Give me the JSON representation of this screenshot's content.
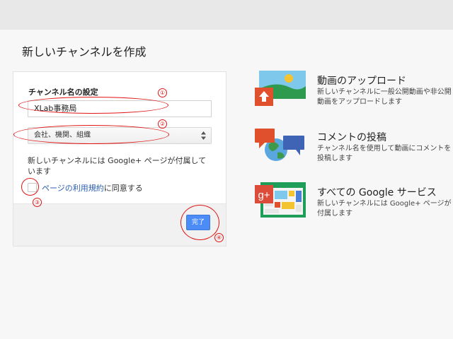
{
  "page": {
    "title": "新しいチャンネルを作成"
  },
  "form": {
    "channel_name_label": "チャンネル名の設定",
    "channel_name_value": "XLab事務局",
    "category_value": "会社、機関、組織",
    "info_text": "新しいチャンネルには Google+ ページが付属しています",
    "agree_link": "ページの利用規約",
    "agree_suffix": "に同意する",
    "done_label": "完了"
  },
  "annotations": {
    "n1": "①",
    "n2": "②",
    "n3": "③",
    "n4": "④",
    "color": "#e01515"
  },
  "features": [
    {
      "icon": "upload-picture-icon",
      "title": "動画のアップロード",
      "desc": "新しいチャンネルに一般公開動画や非公開動画をアップロードします"
    },
    {
      "icon": "comment-globe-icon",
      "title": "コメントの投稿",
      "desc": "チャンネル名を使用して動画にコメントを投稿します"
    },
    {
      "icon": "google-plus-services-icon",
      "title": "すべての Google サービス",
      "desc": "新しいチャンネルには Google+ ページが付属します"
    }
  ],
  "colors": {
    "accent": "#4b8cf6",
    "link": "#2a5db0"
  }
}
